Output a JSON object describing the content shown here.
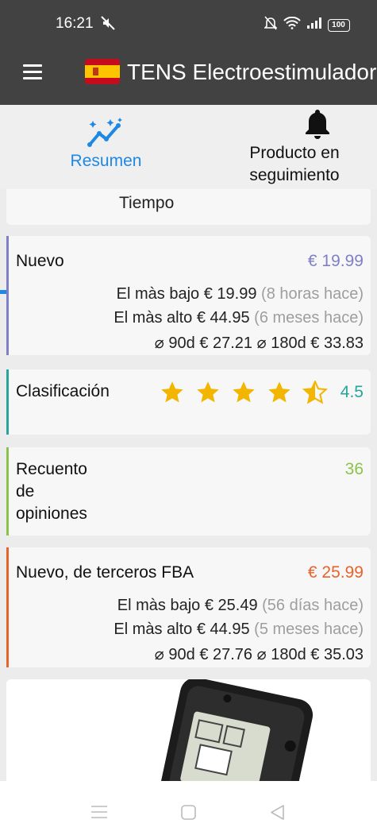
{
  "status_bar": {
    "time": "16:21",
    "battery": "100"
  },
  "app_bar": {
    "title": "TENS Electroestimulador"
  },
  "tabs": [
    {
      "label": "Resumen",
      "icon": "sparkle-trend-icon",
      "active": true
    },
    {
      "label": "Producto en seguimiento",
      "icon": "bell-icon",
      "active": false
    }
  ],
  "cards": {
    "tiempo": {
      "label": "Tiempo"
    },
    "nuevo": {
      "label": "Nuevo",
      "price": "€ 19.99",
      "color": "#7f7fc9",
      "lowest_label": "El màs bajo",
      "lowest_price": "€ 19.99",
      "lowest_when": "(8 horas hace)",
      "highest_label": "El màs alto",
      "highest_price": "€ 44.95",
      "highest_when": "(6 meses hace)",
      "avg_90_label": "⌀ 90d",
      "avg_90": "€ 27.21",
      "avg_180_label": "⌀ 180d",
      "avg_180": "€ 33.83"
    },
    "clasificacion": {
      "label": "Clasificación",
      "rating": "4.5",
      "stars": 4.5,
      "color": "#26a69a"
    },
    "recuento": {
      "label": "Recuento de opiniones",
      "value": "36",
      "color": "#8bc34a"
    },
    "fba": {
      "label": "Nuevo, de terceros FBA",
      "price": "€ 25.99",
      "color": "#e8632a",
      "lowest_label": "El màs bajo",
      "lowest_price": "€ 25.49",
      "lowest_when": "(56 días hace)",
      "highest_label": "El màs alto",
      "highest_price": "€ 44.95",
      "highest_when": "(5 meses hace)",
      "avg_90_label": "⌀ 90d",
      "avg_90": "€ 27.76",
      "avg_180_label": "⌀ 180d",
      "avg_180": "€ 35.03"
    }
  },
  "colors": {
    "accent": "#1e88e5",
    "appbar": "#424242"
  }
}
